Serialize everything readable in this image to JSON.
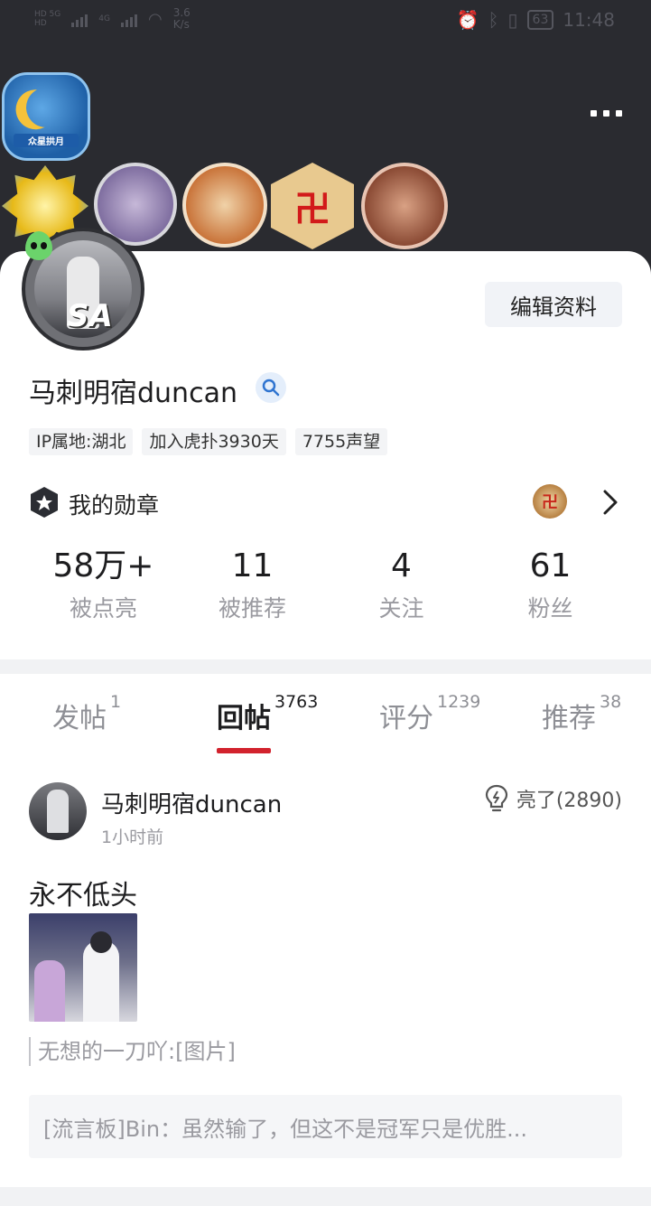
{
  "status_bar": {
    "network_speed": "3.6\nK/s",
    "battery": "63",
    "time": "11:48"
  },
  "header": {
    "badge_top_label": "众星拱月"
  },
  "profile": {
    "edit_label": "编辑资料",
    "username": "马刺明宿duncan",
    "tags": [
      "IP属地:湖北",
      "加入虎扑3930天",
      "7755声望"
    ],
    "medals_label": "我的勋章",
    "stats": [
      {
        "value": "58万+",
        "label": "被点亮"
      },
      {
        "value": "11",
        "label": "被推荐"
      },
      {
        "value": "4",
        "label": "关注"
      },
      {
        "value": "61",
        "label": "粉丝"
      }
    ]
  },
  "tabs": [
    {
      "label": "发帖",
      "count": "1"
    },
    {
      "label": "回帖",
      "count": "3763"
    },
    {
      "label": "评分",
      "count": "1239"
    },
    {
      "label": "推荐",
      "count": "38"
    }
  ],
  "post": {
    "author": "马刺明宿duncan",
    "time": "1小时前",
    "likes": "亮了(2890)",
    "title": "永不低头",
    "quote": "无想的一刀吖:[图片]",
    "comment": "[流言板]Bin：虽然输了，但这不是冠军只是优胜..."
  },
  "colors": {
    "header_bg": "#2a2b30",
    "tab_indicator": "#d2222d"
  }
}
